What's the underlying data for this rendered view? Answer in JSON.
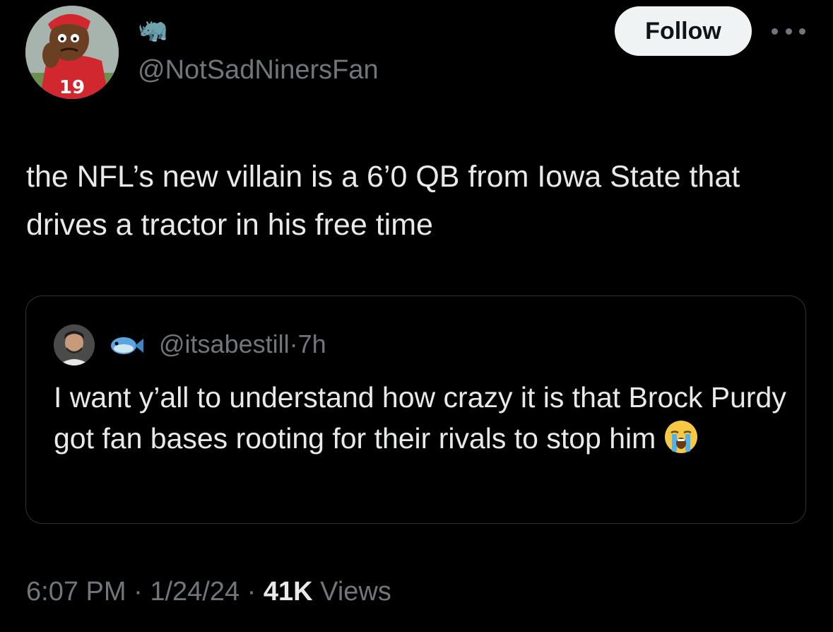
{
  "author": {
    "display_name_emoji": "🦏",
    "handle": "@NotSadNinersFan",
    "avatar_icon": "cartoon-fan-avatar"
  },
  "actions": {
    "follow_label": "Follow",
    "more_icon": "more-horizontal-icon"
  },
  "tweet": {
    "text": "the NFL’s new villain is a 6’0 QB from Iowa State that drives a tractor in his free time"
  },
  "quoted_tweet": {
    "emoji": "🐟",
    "handle": "@itsabestill",
    "separator": "·",
    "time": "7h",
    "text": "I want y’all to understand how crazy it is that Brock Purdy got fan bases rooting for their rivals to stop him",
    "trailing_emoji": "😭"
  },
  "footer": {
    "time": "6:07 PM",
    "sep1": "·",
    "date": "1/24/24",
    "sep2": "·",
    "views_count": "41K",
    "views_label": "Views"
  },
  "colors": {
    "background": "#000000",
    "text": "#e7e9ea",
    "secondary": "#71767b",
    "border": "#2f3336",
    "button_bg": "#eff3f4"
  }
}
